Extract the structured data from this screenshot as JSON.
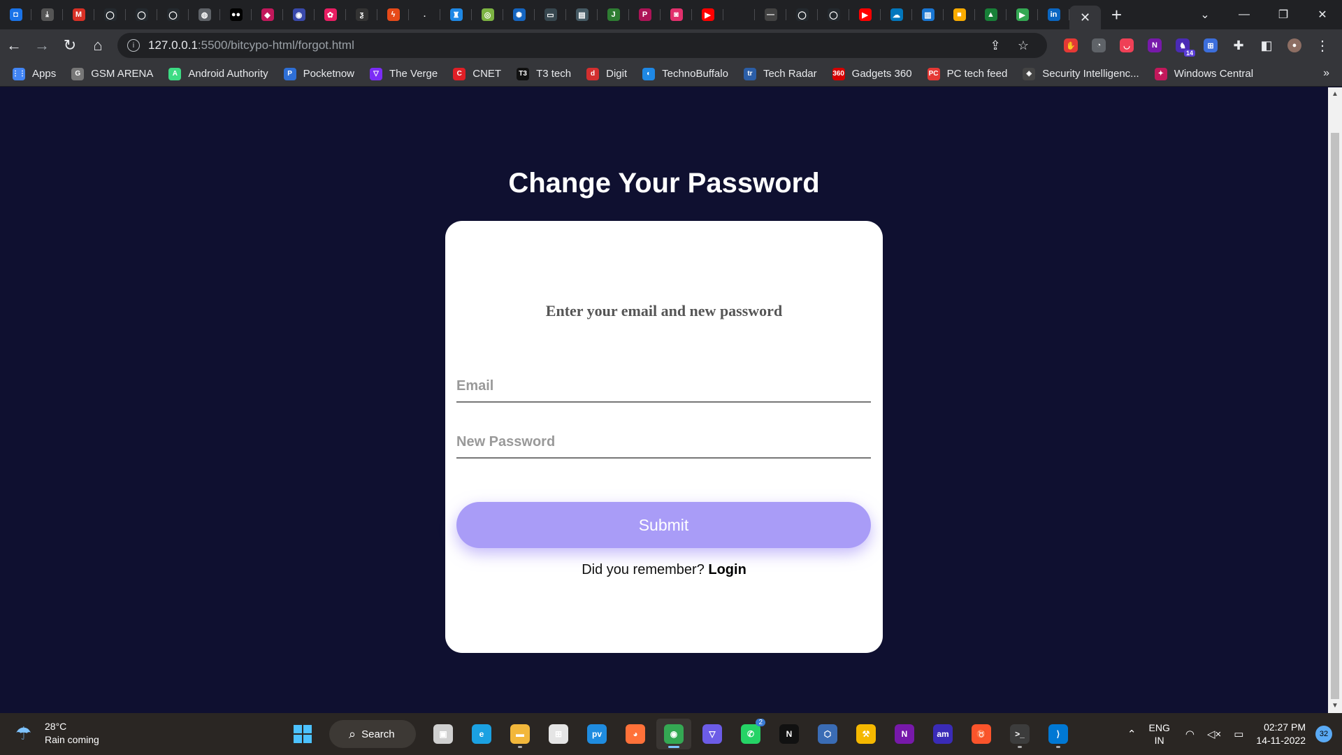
{
  "browser": {
    "tabs": [
      {
        "icon": "tab-favicon-screen",
        "color": "#1a73e8",
        "glyph": "◘"
      },
      {
        "icon": "tab-favicon-download",
        "color": "#555555",
        "glyph": "⤓"
      },
      {
        "icon": "tab-favicon-gmail",
        "color": "#d93025",
        "glyph": "M"
      },
      {
        "icon": "tab-favicon-github",
        "color": "#24292e",
        "glyph": "◯"
      },
      {
        "icon": "tab-favicon-github",
        "color": "#24292e",
        "glyph": "◯"
      },
      {
        "icon": "tab-favicon-github",
        "color": "#24292e",
        "glyph": "◯"
      },
      {
        "icon": "tab-favicon-globe",
        "color": "#5f6368",
        "glyph": "◍"
      },
      {
        "icon": "tab-favicon-medium",
        "color": "#000000",
        "glyph": "●●"
      },
      {
        "icon": "tab-favicon-shield",
        "color": "#c2185b",
        "glyph": "◆"
      },
      {
        "icon": "tab-favicon-location",
        "color": "#3949ab",
        "glyph": "◉"
      },
      {
        "icon": "tab-favicon-flower",
        "color": "#e91e63",
        "glyph": "✿"
      },
      {
        "icon": "tab-favicon-bolt",
        "color": "#333333",
        "glyph": "ƺ"
      },
      {
        "icon": "tab-favicon-lightning",
        "color": "#e64a19",
        "glyph": "ϟ"
      },
      {
        "icon": "tab-favicon-blank",
        "color": "#202124",
        "glyph": "."
      },
      {
        "icon": "tab-favicon-jar",
        "color": "#1e88e5",
        "glyph": "♜"
      },
      {
        "icon": "tab-favicon-leaf",
        "color": "#7cb342",
        "glyph": "◎"
      },
      {
        "icon": "tab-favicon-spiral",
        "color": "#1565c0",
        "glyph": "✺"
      },
      {
        "icon": "tab-favicon-terminal",
        "color": "#37474f",
        "glyph": "▭"
      },
      {
        "icon": "tab-favicon-news",
        "color": "#455a64",
        "glyph": "▤"
      },
      {
        "icon": "tab-favicon-j",
        "color": "#2e7d32",
        "glyph": "J"
      },
      {
        "icon": "tab-favicon-pink",
        "color": "#ad1457",
        "glyph": "P"
      },
      {
        "icon": "tab-favicon-instagram",
        "color": "#e1306c",
        "glyph": "◙"
      },
      {
        "icon": "tab-favicon-youtube",
        "color": "#ff0000",
        "glyph": "▶"
      },
      {
        "icon": "tab-favicon-apple",
        "color": "#202124",
        "glyph": ""
      },
      {
        "icon": "tab-favicon-dash",
        "color": "#424242",
        "glyph": "—"
      },
      {
        "icon": "tab-favicon-github",
        "color": "#24292e",
        "glyph": "◯"
      },
      {
        "icon": "tab-favicon-github",
        "color": "#24292e",
        "glyph": "◯"
      },
      {
        "icon": "tab-favicon-youtube",
        "color": "#ff0000",
        "glyph": "▶"
      },
      {
        "icon": "tab-favicon-cloud",
        "color": "#0277bd",
        "glyph": "☁"
      },
      {
        "icon": "tab-favicon-chart",
        "color": "#1976d2",
        "glyph": "▥"
      },
      {
        "icon": "tab-favicon-keep",
        "color": "#f9ab00",
        "glyph": "■"
      },
      {
        "icon": "tab-favicon-drive",
        "color": "#188038",
        "glyph": "▲"
      },
      {
        "icon": "tab-favicon-android",
        "color": "#34a853",
        "glyph": "▶"
      },
      {
        "icon": "tab-favicon-linkedin",
        "color": "#0a66c2",
        "glyph": "in"
      }
    ],
    "active_tab_close": "✕",
    "new_tab": "+",
    "window_controls": {
      "dropdown": "⌄",
      "minimize": "—",
      "restore": "❐",
      "close": "✕"
    },
    "address": {
      "host": "127.0.0.1",
      "path": ":5500/bitcypo-html/forgot.html"
    },
    "extensions": [
      {
        "name": "adblock-icon",
        "color": "#e53935",
        "glyph": "✋",
        "badge": ""
      },
      {
        "name": "extension-tracker-icon",
        "color": "#5f6368",
        "glyph": "◔",
        "badge": ""
      },
      {
        "name": "pocket-icon",
        "color": "#ef4056",
        "glyph": "◡",
        "badge": ""
      },
      {
        "name": "onenote-icon",
        "color": "#7719aa",
        "glyph": "N",
        "badge": ""
      },
      {
        "name": "wizard-extension-icon",
        "color": "#4a2bb5",
        "glyph": "♞",
        "badge": "14"
      },
      {
        "name": "translate-extension-icon",
        "color": "#3c6edb",
        "glyph": "⊞",
        "badge": ""
      }
    ],
    "bookmarks": [
      {
        "label": "Apps",
        "icon": "apps-grid-icon",
        "color": "#4285f4",
        "glyph": "⋮⋮"
      },
      {
        "label": "GSM ARENA",
        "icon": "gsmarena-icon",
        "color": "#777777",
        "glyph": "G"
      },
      {
        "label": "Android Authority",
        "icon": "android-authority-icon",
        "color": "#3ddc84",
        "glyph": "A"
      },
      {
        "label": "Pocketnow",
        "icon": "pocketnow-icon",
        "color": "#2e6fd6",
        "glyph": "P"
      },
      {
        "label": "The Verge",
        "icon": "the-verge-icon",
        "color": "#7b2cf5",
        "glyph": "▽"
      },
      {
        "label": "CNET",
        "icon": "cnet-icon",
        "color": "#e01f26",
        "glyph": "C"
      },
      {
        "label": "T3 tech",
        "icon": "t3-icon",
        "color": "#111111",
        "glyph": "T3"
      },
      {
        "label": "Digit",
        "icon": "digit-icon",
        "color": "#d32f2f",
        "glyph": "d"
      },
      {
        "label": "TechnoBuffalo",
        "icon": "technobuffalo-icon",
        "color": "#1e88e5",
        "glyph": "◐"
      },
      {
        "label": "Tech Radar",
        "icon": "techradar-icon",
        "color": "#2b5ea7",
        "glyph": "tr"
      },
      {
        "label": "Gadgets 360",
        "icon": "gadgets360-icon",
        "color": "#d50000",
        "glyph": "360"
      },
      {
        "label": "PC tech feed",
        "icon": "pctechfeed-icon",
        "color": "#e53935",
        "glyph": "PC"
      },
      {
        "label": "Security Intelligenc...",
        "icon": "security-shield-icon",
        "color": "#444444",
        "glyph": "◈"
      },
      {
        "label": "Windows Central",
        "icon": "windows-central-icon",
        "color": "#c2185b",
        "glyph": "✦"
      }
    ],
    "bookmarks_more": "»"
  },
  "page": {
    "title": "Change Your Password",
    "subtitle": "Enter your email and new password",
    "email_placeholder": "Email",
    "password_placeholder": "New Password",
    "submit_label": "Submit",
    "remember_text": "Did you remember?",
    "login_link": "Login",
    "colors": {
      "background": "#0f1030",
      "card": "#ffffff",
      "submit": "#a99cf7"
    }
  },
  "taskbar": {
    "weather_temp": "28°C",
    "weather_desc": "Rain coming",
    "search_label": "Search",
    "apps": [
      {
        "name": "task-view-icon",
        "color": "#d0d0d0",
        "glyph": "▣",
        "indicator": false
      },
      {
        "name": "edge-icon",
        "color": "#1ba1e2",
        "glyph": "e",
        "indicator": false
      },
      {
        "name": "file-explorer-icon",
        "color": "#f2b73b",
        "glyph": "▬",
        "indicator": true
      },
      {
        "name": "microsoft-store-icon",
        "color": "#e5e5e5",
        "glyph": "⊞",
        "indicator": false
      },
      {
        "name": "prime-video-icon",
        "color": "#1f8ce0",
        "glyph": "pv",
        "indicator": false
      },
      {
        "name": "firefox-icon",
        "color": "#ff7139",
        "glyph": "◕",
        "indicator": false
      },
      {
        "name": "chrome-icon",
        "color": "#34a853",
        "glyph": "◉",
        "indicator": true,
        "active": true
      },
      {
        "name": "vpn-icon",
        "color": "#6c5ce7",
        "glyph": "▽",
        "indicator": false
      },
      {
        "name": "whatsapp-icon",
        "color": "#25d366",
        "glyph": "✆",
        "indicator": false,
        "badge": "2"
      },
      {
        "name": "notion-icon",
        "color": "#111111",
        "glyph": "N",
        "indicator": false
      },
      {
        "name": "virtualbox-icon",
        "color": "#3a6cb5",
        "glyph": "⬡",
        "indicator": false
      },
      {
        "name": "yellow-tool-icon",
        "color": "#f5b800",
        "glyph": "⚒",
        "indicator": false
      },
      {
        "name": "onenote-icon",
        "color": "#7719aa",
        "glyph": "N",
        "indicator": false
      },
      {
        "name": "amazon-music-icon",
        "color": "#3a2bb7",
        "glyph": "am",
        "indicator": false
      },
      {
        "name": "brave-icon",
        "color": "#fb542b",
        "glyph": "♉",
        "indicator": false
      },
      {
        "name": "terminal-icon",
        "color": "#3c3c3c",
        "glyph": ">_",
        "indicator": true
      },
      {
        "name": "vscode-icon",
        "color": "#0078d4",
        "glyph": "⟩",
        "indicator": true
      }
    ],
    "lang_top": "ENG",
    "lang_bottom": "IN",
    "time": "02:27 PM",
    "date": "14-11-2022",
    "notifications": "32"
  }
}
